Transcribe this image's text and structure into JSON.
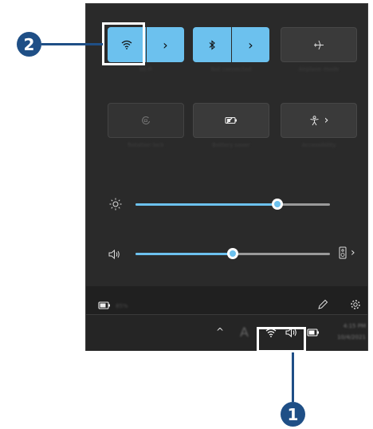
{
  "tiles": {
    "wifi": {
      "label": "Wi-Fi",
      "chevron": "›"
    },
    "bluetooth": {
      "label": "Not connected",
      "chevron": "›"
    },
    "airplane": {
      "label": "Airplane mode"
    },
    "rotation": {
      "label": "Rotation lock"
    },
    "battery_saver": {
      "label": "Battery saver"
    },
    "accessibility": {
      "label": "Accessibility",
      "chevron": "›"
    }
  },
  "sliders": {
    "brightness": {
      "icon": "sun-icon",
      "level": 0.73
    },
    "volume": {
      "icon": "speaker-icon",
      "level": 0.5,
      "chevron": "›"
    }
  },
  "footer": {
    "battery_text": "85%"
  },
  "taskbar": {
    "time": "4:15 PM",
    "date": "10/4/2021",
    "chevron_up": "^"
  },
  "callouts": {
    "one": "1",
    "two": "2"
  },
  "colors": {
    "accent": "#6cc1ee",
    "callout": "#1f4f86",
    "panel": "#2a2a2a"
  }
}
